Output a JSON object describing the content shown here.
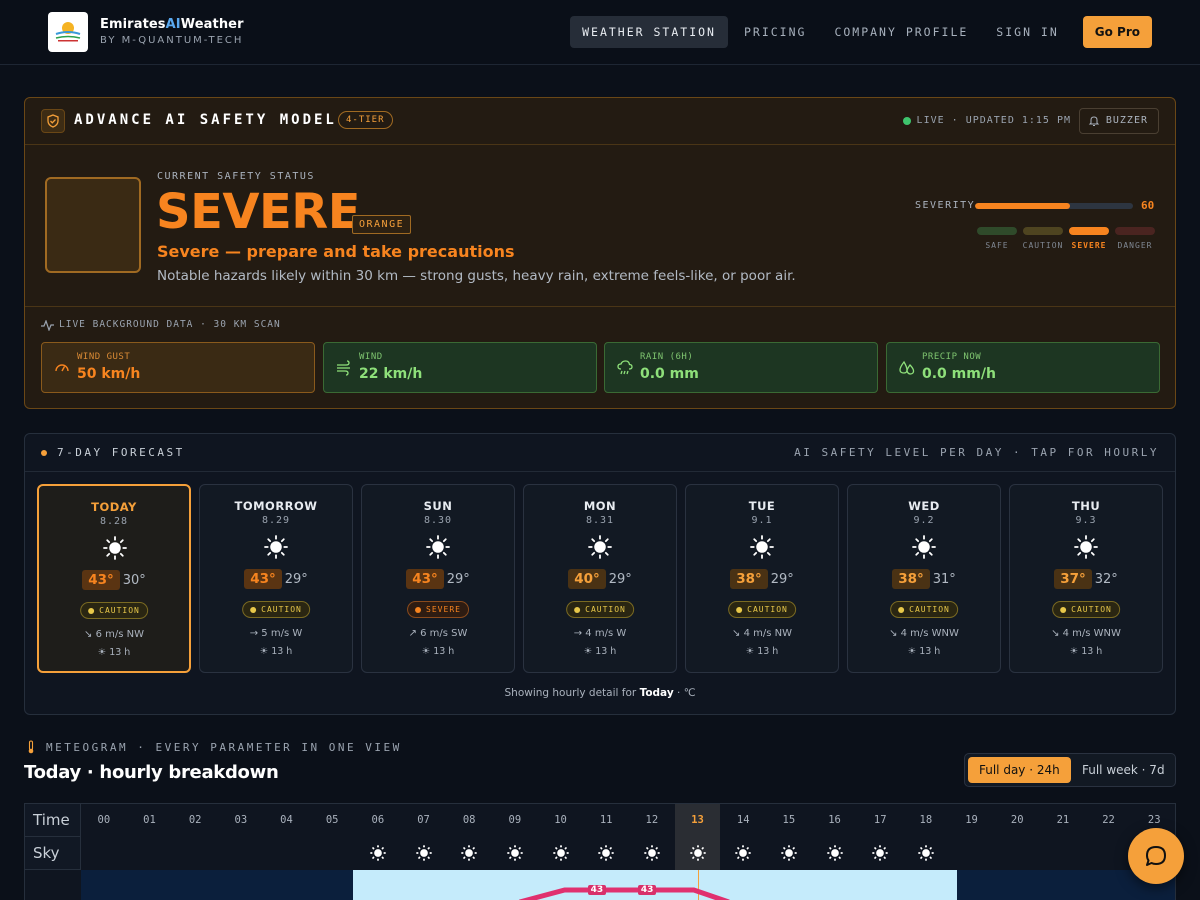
{
  "header": {
    "brand_prefix": "Emirates",
    "brand_ai": "AI",
    "brand_suffix": "Weather",
    "brand_sub": "BY M-QUANTUM-TECH",
    "nav": [
      "WEATHER STATION",
      "PRICING",
      "COMPANY PROFILE",
      "SIGN IN"
    ],
    "cta": "Go Pro"
  },
  "safety": {
    "title": "ADVANCE AI SAFETY MODEL",
    "tier": "4-TIER",
    "live": "LIVE · UPDATED 1:15 PM",
    "buzzer": "BUZZER",
    "status_label": "CURRENT SAFETY STATUS",
    "status": "SEVERE",
    "color_tag": "ORANGE",
    "headline": "Severe — prepare and take precautions",
    "description": "Notable hazards likely within 30 km — strong gusts, heavy rain, extreme feels-like, or poor air.",
    "severity_label": "SEVERITY",
    "severity_value": "60",
    "severity_fraction": 0.6,
    "levels": [
      {
        "label": "SAFE",
        "color": "#2f4a2a"
      },
      {
        "label": "CAUTION",
        "color": "#4e4420"
      },
      {
        "label": "SEVERE",
        "color": "#f7841f"
      },
      {
        "label": "DANGER",
        "color": "#4a2420"
      }
    ],
    "background_label": "LIVE BACKGROUND DATA · 30 KM SCAN",
    "cards": [
      {
        "label": "WIND GUST",
        "value": "50 km/h",
        "icon": "gauge-icon"
      },
      {
        "label": "WIND",
        "value": "22 km/h",
        "icon": "wind-icon"
      },
      {
        "label": "RAIN (6H)",
        "value": "0.0 mm",
        "icon": "cloud-rain-icon"
      },
      {
        "label": "PRECIP NOW",
        "value": "0.0 mm/h",
        "icon": "droplets-icon"
      }
    ]
  },
  "forecast": {
    "title": "7-DAY FORECAST",
    "subtitle": "AI SAFETY LEVEL PER DAY · TAP FOR HOURLY",
    "days": [
      {
        "name": "TODAY",
        "date": "8.28",
        "hi": "43°",
        "lo": "30°",
        "level": "CAUTION",
        "wind": "↘ 6 m/s NW",
        "sun": "☀ 13 h"
      },
      {
        "name": "TOMORROW",
        "date": "8.29",
        "hi": "43°",
        "lo": "29°",
        "level": "CAUTION",
        "wind": "→ 5 m/s W",
        "sun": "☀ 13 h"
      },
      {
        "name": "SUN",
        "date": "8.30",
        "hi": "43°",
        "lo": "29°",
        "level": "SEVERE",
        "wind": "↗ 6 m/s SW",
        "sun": "☀ 13 h"
      },
      {
        "name": "MON",
        "date": "8.31",
        "hi": "40°",
        "lo": "29°",
        "level": "CAUTION",
        "wind": "→ 4 m/s W",
        "sun": "☀ 13 h"
      },
      {
        "name": "TUE",
        "date": "9.1",
        "hi": "38°",
        "lo": "29°",
        "level": "CAUTION",
        "wind": "↘ 4 m/s NW",
        "sun": "☀ 13 h"
      },
      {
        "name": "WED",
        "date": "9.2",
        "hi": "38°",
        "lo": "31°",
        "level": "CAUTION",
        "wind": "↘ 4 m/s WNW",
        "sun": "☀ 13 h"
      },
      {
        "name": "THU",
        "date": "9.3",
        "hi": "37°",
        "lo": "32°",
        "level": "CAUTION",
        "wind": "↘ 4 m/s WNW",
        "sun": "☀ 13 h"
      }
    ],
    "footer_prefix": "Showing hourly detail for",
    "footer_day": "Today",
    "footer_unit": "· ℃"
  },
  "meteogram": {
    "label": "METEOGRAM · EVERY PARAMETER IN ONE VIEW",
    "title": "Today · hourly breakdown",
    "toggle": [
      "Full day · 24h",
      "Full week · 7d"
    ],
    "row_time": "Time",
    "row_sky": "Sky",
    "hours": [
      "00",
      "01",
      "02",
      "03",
      "04",
      "05",
      "06",
      "07",
      "08",
      "09",
      "10",
      "11",
      "12",
      "13",
      "14",
      "15",
      "16",
      "17",
      "18",
      "19",
      "20",
      "21",
      "22",
      "23"
    ],
    "current_hour": "13",
    "sunny_hours": [
      "06",
      "07",
      "08",
      "09",
      "10",
      "11",
      "12",
      "13",
      "14",
      "15",
      "16",
      "17",
      "18"
    ],
    "peak_labels": [
      "43",
      "43"
    ]
  },
  "colors": {
    "accent": "#f5a03a",
    "severe": "#f7841f",
    "safe": "#8ee07a",
    "caution": "#e8c84a"
  }
}
